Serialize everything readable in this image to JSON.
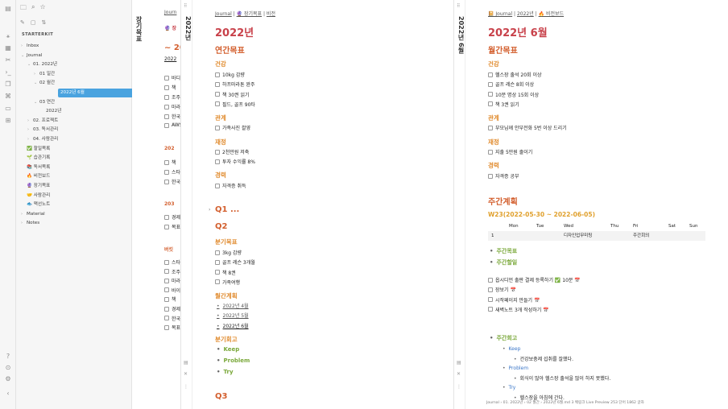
{
  "sidebar": {
    "vault_name": "STARTERKIT",
    "tree": [
      {
        "label": "Inbox",
        "arrow": "›"
      },
      {
        "label": "Journal",
        "arrow": "⌄"
      },
      {
        "label": "01. 2022년",
        "arrow": "⌄"
      },
      {
        "label": "01 일간",
        "arrow": "›"
      },
      {
        "label": "02 월간",
        "arrow": "⌄"
      },
      {
        "label": "2022년 6월",
        "arrow": ""
      },
      {
        "label": "03 연간",
        "arrow": "⌄"
      },
      {
        "label": "2022년",
        "arrow": ""
      },
      {
        "label": "02. 프로젝트",
        "arrow": "›"
      },
      {
        "label": "03. 독서관리",
        "arrow": "›"
      },
      {
        "label": "04. 사람관리",
        "arrow": "›"
      },
      {
        "label": "✅ 할일목록",
        "arrow": ""
      },
      {
        "label": "🌱 습관기록",
        "arrow": ""
      },
      {
        "label": "📚 독서목록",
        "arrow": ""
      },
      {
        "label": "🔥 비전보드",
        "arrow": ""
      },
      {
        "label": "🔮 장기목표",
        "arrow": ""
      },
      {
        "label": "🤝 사람관리",
        "arrow": ""
      },
      {
        "label": "🐟 맥선노트",
        "arrow": ""
      },
      {
        "label": "Material",
        "arrow": "›"
      },
      {
        "label": "Notes",
        "arrow": "›"
      }
    ]
  },
  "pane1": {
    "tab_title": "장기목표",
    "nav": "Journ",
    "heading": "🔮 장",
    "sub": "~ 20",
    "year": "2022",
    "tasks": [
      "바디",
      "책",
      "조주",
      "마라",
      "한국",
      "AWS"
    ],
    "h2a": "202",
    "tasks2": [
      "책",
      "스타",
      "한국"
    ],
    "h2b": "203",
    "tasks3": [
      "경제",
      "목표"
    ],
    "h2c": "버킷",
    "tasks4": [
      "스타",
      "조주",
      "마라",
      "바이",
      "책",
      "경제",
      "한국",
      "목표"
    ]
  },
  "pane2": {
    "tab_title": "2022년",
    "nav": {
      "journal": "Journal",
      "goal": "🔮 장기목표",
      "vision": "비전"
    },
    "title": "2022년",
    "annual_goal": "연간목표",
    "health": "건강",
    "health_tasks": [
      "10kg 감량",
      "하프마라톤 완주",
      "책 30권 읽기",
      "필드, 골프 90타"
    ],
    "relation": "관계",
    "relation_tasks": [
      "가족사진 촬영"
    ],
    "wealth": "재정",
    "wealth_tasks": [
      "2천만원 저축",
      "투자 수익률 8%"
    ],
    "career": "경력",
    "career_tasks": [
      "자격증 취득"
    ],
    "q1": "Q1 ...",
    "q2": "Q2",
    "quarter_goal": "분기목표",
    "q2_tasks": [
      "3kg 감량",
      "골프 레슨 3개월",
      "책 8권",
      "가족여행"
    ],
    "monthly_plan": "월간계획",
    "months": [
      "2022년 4월",
      "2022년 5월",
      "2022년 6월"
    ],
    "review": "분기회고",
    "review_items": [
      "Keep",
      "Problem",
      "Try"
    ],
    "q3": "Q3"
  },
  "pane3": {
    "tab_title": "2022년 6월",
    "nav": {
      "journal": "📔 Journal",
      "year": "2022년",
      "vision": "🔥 비전보드"
    },
    "title": "2022년 6월",
    "monthly_goal": "월간목표",
    "health": "건강",
    "health_tasks": [
      "헬스장 출석 20회 이상",
      "골프 레슨 8회 이상",
      "10분 명상 15회 이상",
      "책 3권 읽기"
    ],
    "relation": "관계",
    "relation_tasks": [
      "부모님께 안부전화 5번 이상 드리기"
    ],
    "wealth": "재정",
    "wealth_tasks": [
      "지출 5만원 줄이기"
    ],
    "career": "경력",
    "career_tasks": [
      "자격증 공부"
    ],
    "weekly_plan": "주간계획",
    "week": "W23(2022-05-30 ~ 2022-06-05)",
    "table_head": [
      "",
      "Mon",
      "Tue",
      "Wed",
      "Thu",
      "Fri",
      "Sat",
      "Sun"
    ],
    "table_row": [
      "1",
      "",
      "",
      "디자인업무미팅",
      "",
      "주간회의",
      "",
      ""
    ],
    "weekly_goal": "주간목표",
    "weekly_todo": "주간할일",
    "todos": [
      "옵시디언 출판 결제 등록하기 ✅ 10분 📅",
      "장보기 📅",
      "시작페이지 만들기 📅",
      "새벽노트 3개 작성하기 📅"
    ],
    "weekly_review": "주간회고",
    "keep": "Keep",
    "keep_text": "건강보충제 섭취를 잘했다.",
    "problem": "Problem",
    "problem_text": "회식이 많아 헬스장 출석을 많이 하지 못했다.",
    "try": "Try",
    "try_text": "헬스장을 아침에 간다."
  },
  "statusbar": "Journal › 01. 2022년 › 02 월간 › 2022년 6월.md   3 백링크   Live Preview   253 단어   1862 글자"
}
